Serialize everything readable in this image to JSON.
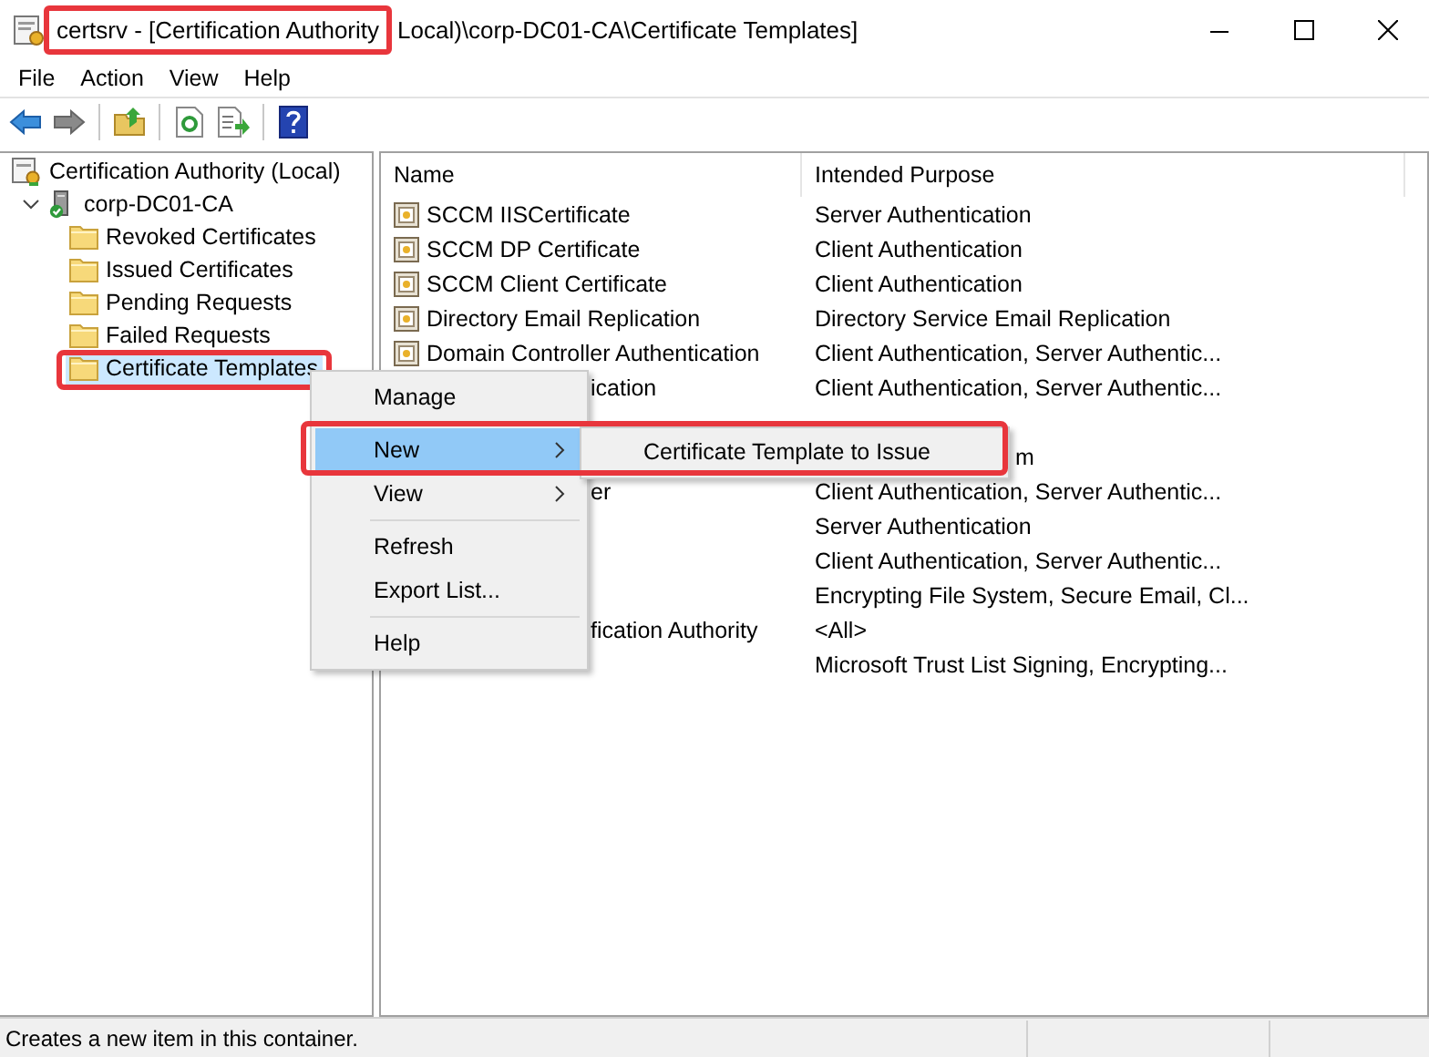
{
  "window": {
    "title_highlighted": "certsrv - [Certification Authority",
    "title_rest": "Local)\\corp-DC01-CA\\Certificate Templates]"
  },
  "menu_bar": [
    "File",
    "Action",
    "View",
    "Help"
  ],
  "tree": [
    {
      "label": "Certification Authority (Local)",
      "kind": "console",
      "selected": false,
      "annotated": false,
      "children": [
        {
          "label": "corp-DC01-CA",
          "kind": "server",
          "expanded": true,
          "selected": false,
          "annotated": false,
          "children": [
            {
              "label": "Revoked Certificates",
              "kind": "folder",
              "selected": false,
              "annotated": false
            },
            {
              "label": "Issued Certificates",
              "kind": "folder",
              "selected": false,
              "annotated": false
            },
            {
              "label": "Pending Requests",
              "kind": "folder",
              "selected": false,
              "annotated": false
            },
            {
              "label": "Failed Requests",
              "kind": "folder",
              "selected": false,
              "annotated": false
            },
            {
              "label": "Certificate Templates",
              "kind": "folder",
              "selected": true,
              "annotated": true
            }
          ]
        }
      ]
    }
  ],
  "table": {
    "columns": [
      "Name",
      "Intended Purpose"
    ],
    "rows": [
      {
        "name": "SCCM IISCertificate",
        "purpose": "Server Authentication"
      },
      {
        "name": "SCCM DP Certificate",
        "purpose": "Client Authentication"
      },
      {
        "name": "SCCM Client Certificate",
        "purpose": "Client Authentication"
      },
      {
        "name": "Directory Email Replication",
        "purpose": "Directory Service Email Replication"
      },
      {
        "name": "Domain Controller Authentication",
        "purpose": "Client Authentication, Server Authentic..."
      },
      {
        "name": "ication",
        "name_clipped": true,
        "purpose": "Client Authentication, Server Authentic..."
      },
      {},
      {
        "purpose": "m",
        "purpose_clipped": true
      },
      {
        "name": "er",
        "name_clipped": true,
        "purpose": "Client Authentication, Server Authentic..."
      },
      {
        "purpose": "Server Authentication"
      },
      {
        "purpose": "Client Authentication, Server Authentic..."
      },
      {
        "purpose": "Encrypting File System, Secure Email, Cl..."
      },
      {
        "name": "fication Authority",
        "name_clipped": true,
        "purpose": "<All>"
      },
      {
        "purpose": "Microsoft Trust List Signing, Encrypting..."
      }
    ]
  },
  "context_menu": {
    "items": [
      {
        "kind": "item",
        "label": "Manage",
        "has_submenu": false,
        "selected": false
      },
      {
        "kind": "separator"
      },
      {
        "kind": "item",
        "label": "New",
        "has_submenu": true,
        "selected": true,
        "annotated": true,
        "submenu": [
          "Certificate Template to Issue"
        ]
      },
      {
        "kind": "item",
        "label": "View",
        "has_submenu": true,
        "selected": false
      },
      {
        "kind": "separator"
      },
      {
        "kind": "item",
        "label": "Refresh",
        "has_submenu": false,
        "selected": false
      },
      {
        "kind": "item",
        "label": "Export List...",
        "has_submenu": false,
        "selected": false
      },
      {
        "kind": "separator"
      },
      {
        "kind": "item",
        "label": "Help",
        "has_submenu": false,
        "selected": false
      }
    ]
  },
  "status_bar": "Creates a new item in this container."
}
